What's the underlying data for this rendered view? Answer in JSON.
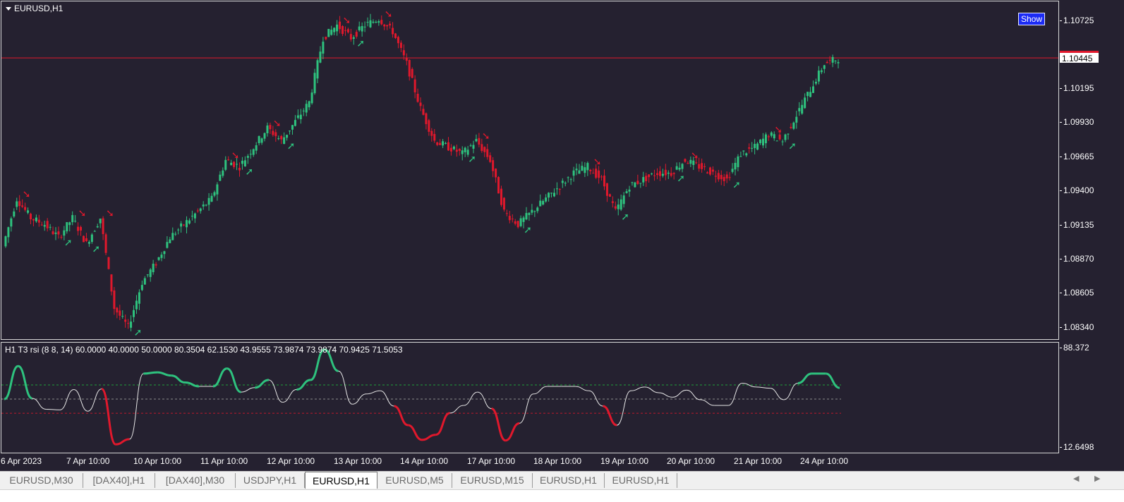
{
  "chart": {
    "symbol_title": "EURUSD,H1",
    "show_button": "Show",
    "current_price": "1.10445",
    "price_ticks": [
      "1.10725",
      "1.10195",
      "1.09930",
      "1.09665",
      "1.09400",
      "1.09135",
      "1.08870",
      "1.08605",
      "1.08340"
    ],
    "indicator_label": "H1 T3 rsi  (8 8, 14) 60.0000 40.0000 50.0000 80.3504 62.1530 43.9555 73.9874 73.9874 70.9425 71.5053",
    "indicator_max": "88.372",
    "indicator_min": "12.6498",
    "time_labels": [
      "6 Apr 2023",
      "7 Apr 10:00",
      "10 Apr 10:00",
      "11 Apr 10:00",
      "12 Apr 10:00",
      "13 Apr 10:00",
      "14 Apr 10:00",
      "17 Apr 10:00",
      "18 Apr 10:00",
      "19 Apr 10:00",
      "20 Apr 10:00",
      "21 Apr 10:00",
      "24 Apr 10:00"
    ],
    "colors": {
      "background": "#252130",
      "bull": "#2ec27e",
      "bear": "#e0182c",
      "bid_line": "#e0182c",
      "rsi_neutral": "#e6e6e6"
    }
  },
  "tabs": [
    {
      "label": "EURUSD,M30",
      "active": false
    },
    {
      "label": "[DAX40],H1",
      "active": false
    },
    {
      "label": "[DAX40],M30",
      "active": false
    },
    {
      "label": "USDJPY,H1",
      "active": false
    },
    {
      "label": "EURUSD,H1",
      "active": true
    },
    {
      "label": "EURUSD,M5",
      "active": false
    },
    {
      "label": "EURUSD,M15",
      "active": false
    },
    {
      "label": "EURUSD,H1",
      "active": false
    },
    {
      "label": "EURUSD,H1",
      "active": false
    }
  ],
  "chart_data": {
    "type": "line",
    "series": [
      {
        "values": [
          1.0898,
          1.0935,
          1.092,
          1.0915,
          1.0905,
          1.092,
          1.09,
          1.092,
          1.085,
          1.0835,
          1.087,
          1.0885,
          1.0905,
          1.0915,
          1.0925,
          1.0935,
          1.0965,
          1.096,
          1.0975,
          1.099,
          1.098,
          1.0995,
          1.101,
          1.106,
          1.107,
          1.106,
          1.107,
          1.1075,
          1.1065,
          1.104,
          1.1005,
          1.098,
          1.0975,
          1.097,
          1.098,
          1.0965,
          1.0925,
          1.0915,
          1.0925,
          1.0935,
          1.0945,
          1.0955,
          1.096,
          1.095,
          1.0925,
          1.0945,
          1.095,
          1.0955,
          1.0955,
          1.0965,
          1.096,
          1.0955,
          1.095,
          1.097,
          1.0975,
          1.0985,
          1.098,
          1.1,
          1.102,
          1.104,
          1.1044
        ]
      }
    ]
  }
}
